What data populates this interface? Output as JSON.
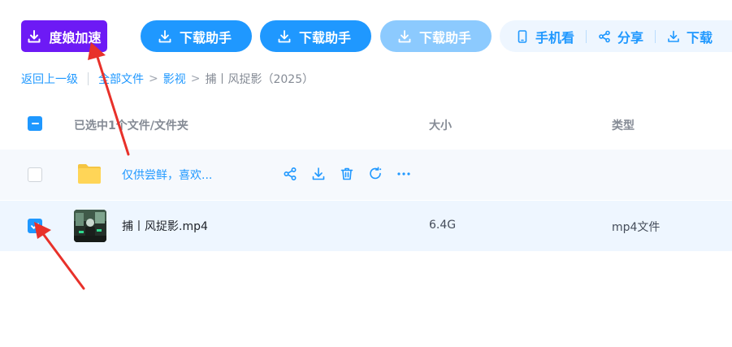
{
  "toolbar": {
    "speed_button": "度娘加速",
    "download_helper_1": "下载助手",
    "download_helper_2": "下载助手",
    "download_helper_3": "下载助手",
    "phone_view": "手机看",
    "share": "分享",
    "download": "下载"
  },
  "breadcrumb": {
    "back": "返回上一级",
    "root": "全部文件",
    "level1": "影视",
    "current": "捕丨风捉影（2025）",
    "chevron": ">"
  },
  "table": {
    "select_summary": "已选中1个文件/文件夹",
    "col_size": "大小",
    "col_type": "类型",
    "rows": [
      {
        "name": "仅供尝鲜，喜欢...",
        "kind": "folder",
        "size": "",
        "type": "",
        "checked": false
      },
      {
        "name": "捕丨风捉影.mp4",
        "kind": "file",
        "size": "6.4G",
        "type": "mp4文件",
        "checked": true
      }
    ]
  },
  "colors": {
    "accent": "#1f98ff",
    "speed_purple": "#6d1af5",
    "arrow_red": "#e8312a"
  },
  "icons": [
    "download-icon",
    "phone-icon",
    "share-icon",
    "delete-icon",
    "refresh-icon",
    "more-icon",
    "folder-icon"
  ]
}
